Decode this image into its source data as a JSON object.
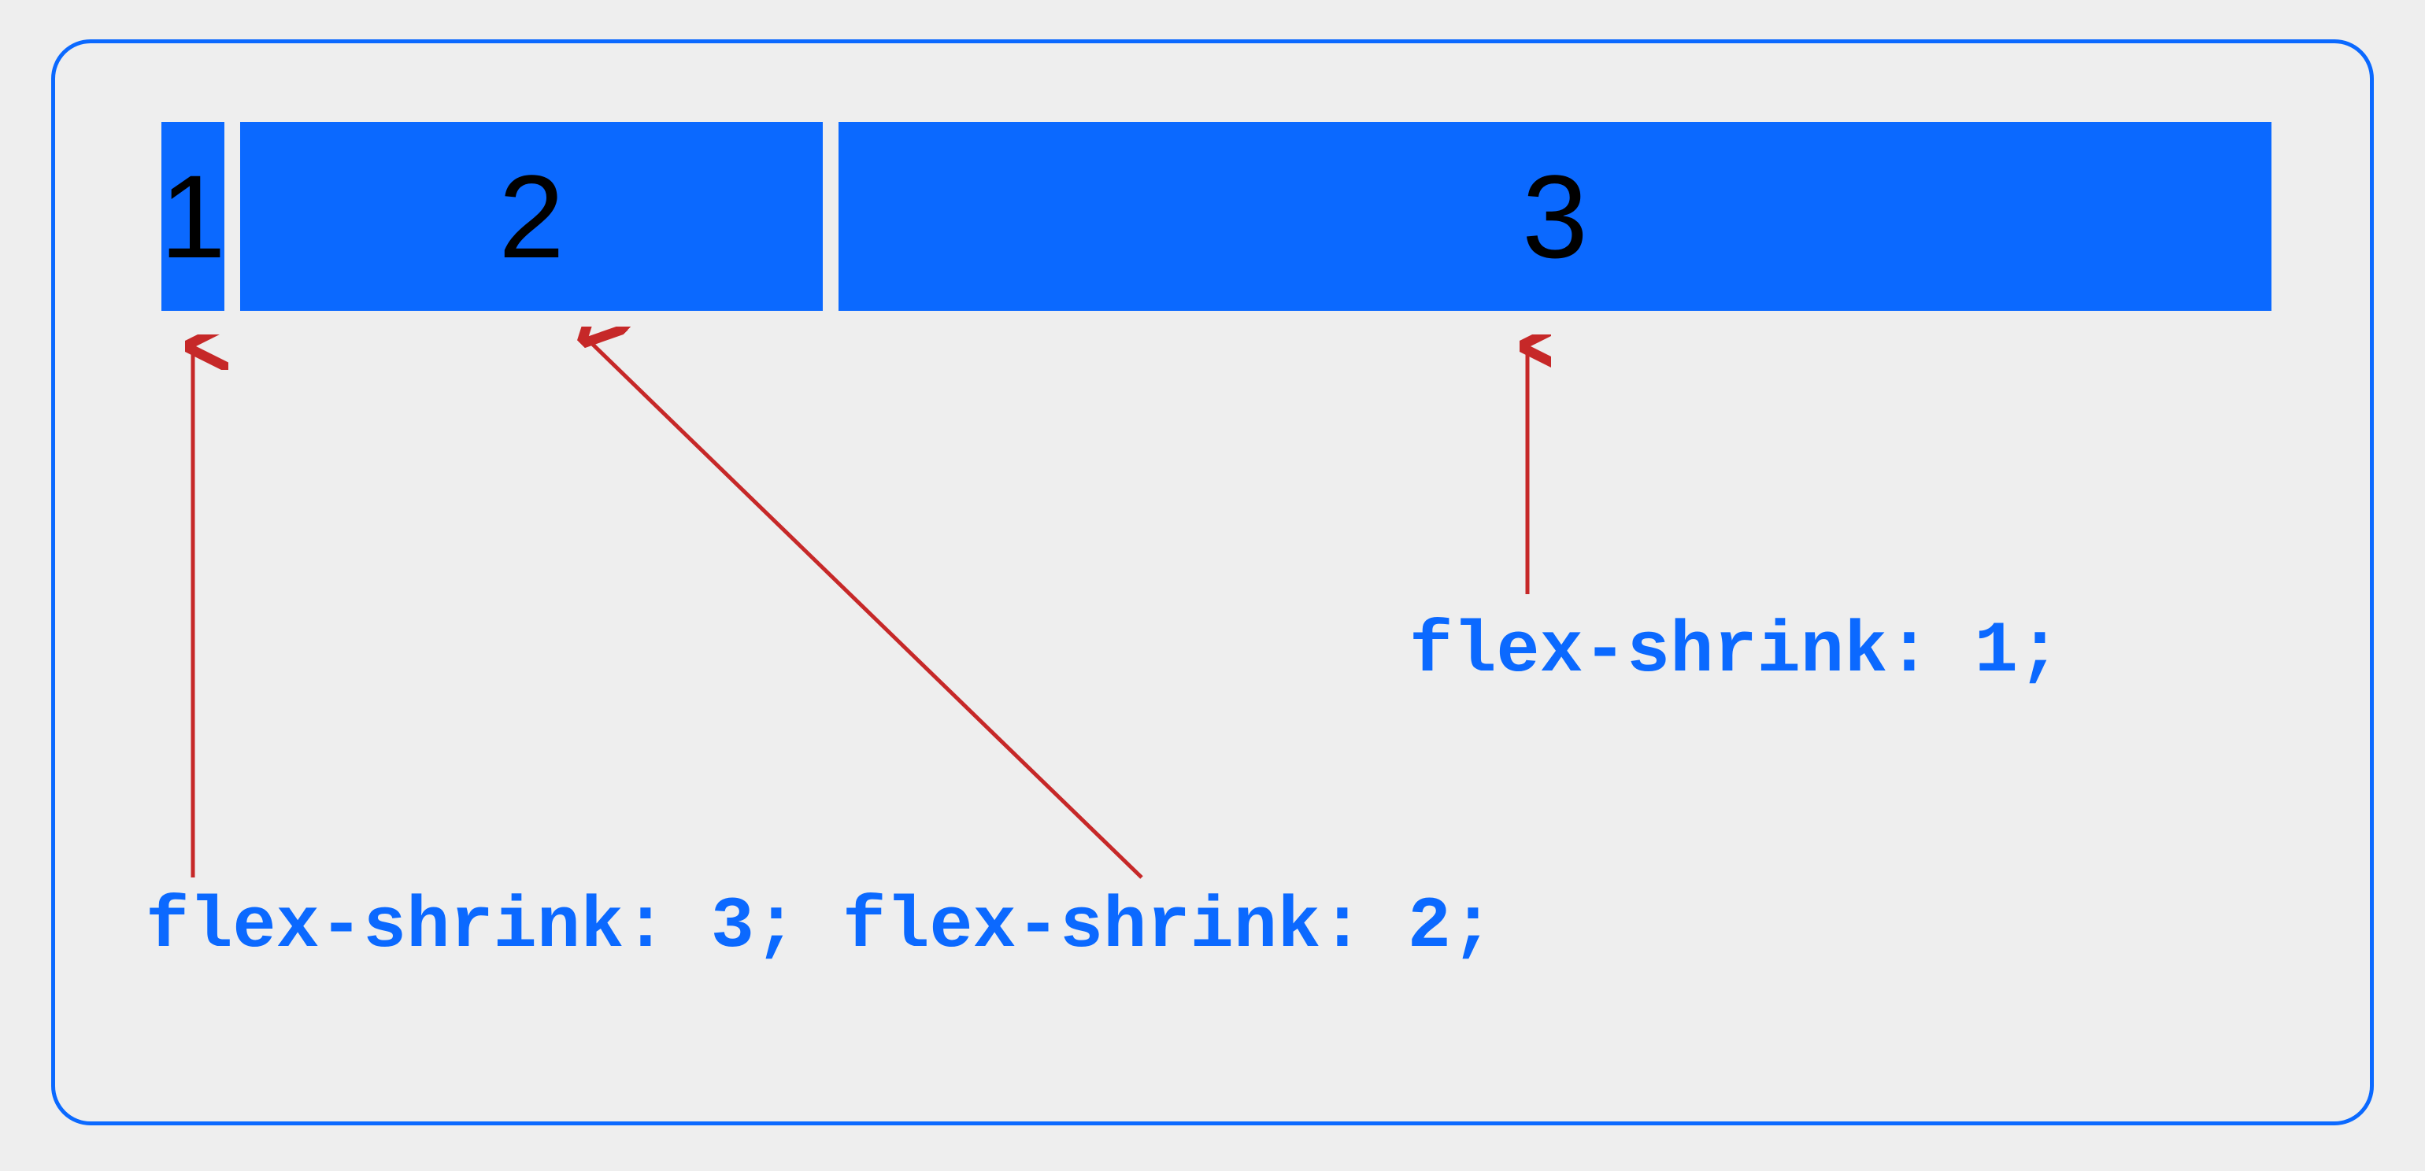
{
  "items": {
    "one": "1",
    "two": "2",
    "three": "3"
  },
  "labels": {
    "one": "flex-shrink: 3;",
    "two": "flex-shrink: 2;",
    "three": "flex-shrink: 1;"
  },
  "colors": {
    "accent": "#0b69ff",
    "arrow": "#c62828",
    "background": "#eeeeee"
  }
}
